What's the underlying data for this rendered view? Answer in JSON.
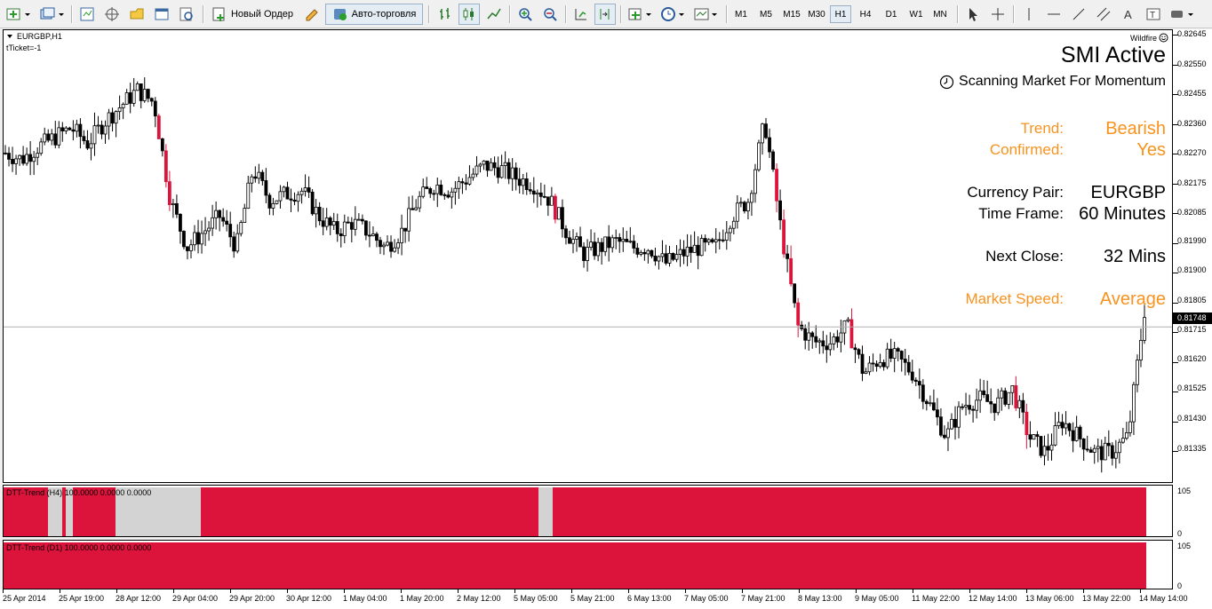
{
  "toolbar": {
    "new_order_label": "Новый Ордер",
    "autotrading_label": "Авто-торговля",
    "timeframes": [
      "M1",
      "M5",
      "M15",
      "M30",
      "H1",
      "H4",
      "D1",
      "W1",
      "MN"
    ],
    "selected_timeframe": "H1"
  },
  "chart": {
    "symbol_label": "EURGBP,H1",
    "ticket_label": "tTicket=-1",
    "brand_label": "Wildfire",
    "current_price": "0.81748"
  },
  "panel": {
    "title": "SMI Active",
    "subtitle": "Scanning Market For Momentum",
    "trend_label": "Trend:",
    "trend_value": "Bearish",
    "confirmed_label": "Confirmed:",
    "confirmed_value": "Yes",
    "pair_label": "Currency Pair:",
    "pair_value": "EURGBP",
    "tf_label": "Time Frame:",
    "tf_value": "60 Minutes",
    "close_label": "Next Close:",
    "close_value": "32 Mins",
    "speed_label": "Market Speed:",
    "speed_value": "Average",
    "accent_color": "#f7931e"
  },
  "price_axis": [
    "0.82645",
    "0.82550",
    "0.82455",
    "0.82360",
    "0.82270",
    "0.82175",
    "0.82085",
    "0.81990",
    "0.81900",
    "0.81805",
    "0.81715",
    "0.81620",
    "0.81525",
    "0.81430",
    "0.81335"
  ],
  "time_axis": [
    "25 Apr 2014",
    "25 Apr 19:00",
    "28 Apr 12:00",
    "29 Apr 04:00",
    "29 Apr 20:00",
    "30 Apr 12:00",
    "1 May 04:00",
    "1 May 20:00",
    "2 May 12:00",
    "5 May 05:00",
    "5 May 21:00",
    "6 May 13:00",
    "7 May 05:00",
    "7 May 21:00",
    "8 May 13:00",
    "9 May 05:00",
    "11 May 22:00",
    "12 May 14:00",
    "13 May 06:00",
    "13 May 22:00",
    "14 May 14:00"
  ],
  "subwindows": [
    {
      "label": "DTT-Trend (H4) 100.0000 0.0000 0.0000",
      "scale_top": "105",
      "scale_bottom": "0"
    },
    {
      "label": "DTT-Trend (D1) 100.0000 0.0000 0.0000",
      "scale_top": "105",
      "scale_bottom": "0"
    }
  ],
  "colors": {
    "bear": "#dc143c",
    "neutral": "#d3d3d3"
  },
  "chart_data": {
    "type": "candlestick",
    "symbol": "EURGBP",
    "timeframe": "H1",
    "ylim": [
      0.8125,
      0.8269
    ],
    "current_price": 0.81748,
    "approx_close_path": [
      0.823,
      0.8228,
      0.8232,
      0.8235,
      0.8238,
      0.8233,
      0.824,
      0.8245,
      0.825,
      0.8246,
      0.8215,
      0.82,
      0.8205,
      0.821,
      0.82,
      0.8225,
      0.8215,
      0.8217,
      0.8218,
      0.821,
      0.8205,
      0.8208,
      0.8205,
      0.82,
      0.8205,
      0.8215,
      0.822,
      0.8218,
      0.8222,
      0.8226,
      0.8225,
      0.8222,
      0.822,
      0.8215,
      0.8205,
      0.8198,
      0.82,
      0.8202,
      0.82,
      0.82,
      0.8195,
      0.8198,
      0.82,
      0.82,
      0.821,
      0.8215,
      0.824,
      0.8205,
      0.8175,
      0.817,
      0.817,
      0.8175,
      0.816,
      0.8165,
      0.8165,
      0.816,
      0.815,
      0.814,
      0.815,
      0.8152,
      0.815,
      0.8155,
      0.814,
      0.8135,
      0.8145,
      0.814,
      0.8135,
      0.8135,
      0.814,
      0.818
    ]
  }
}
